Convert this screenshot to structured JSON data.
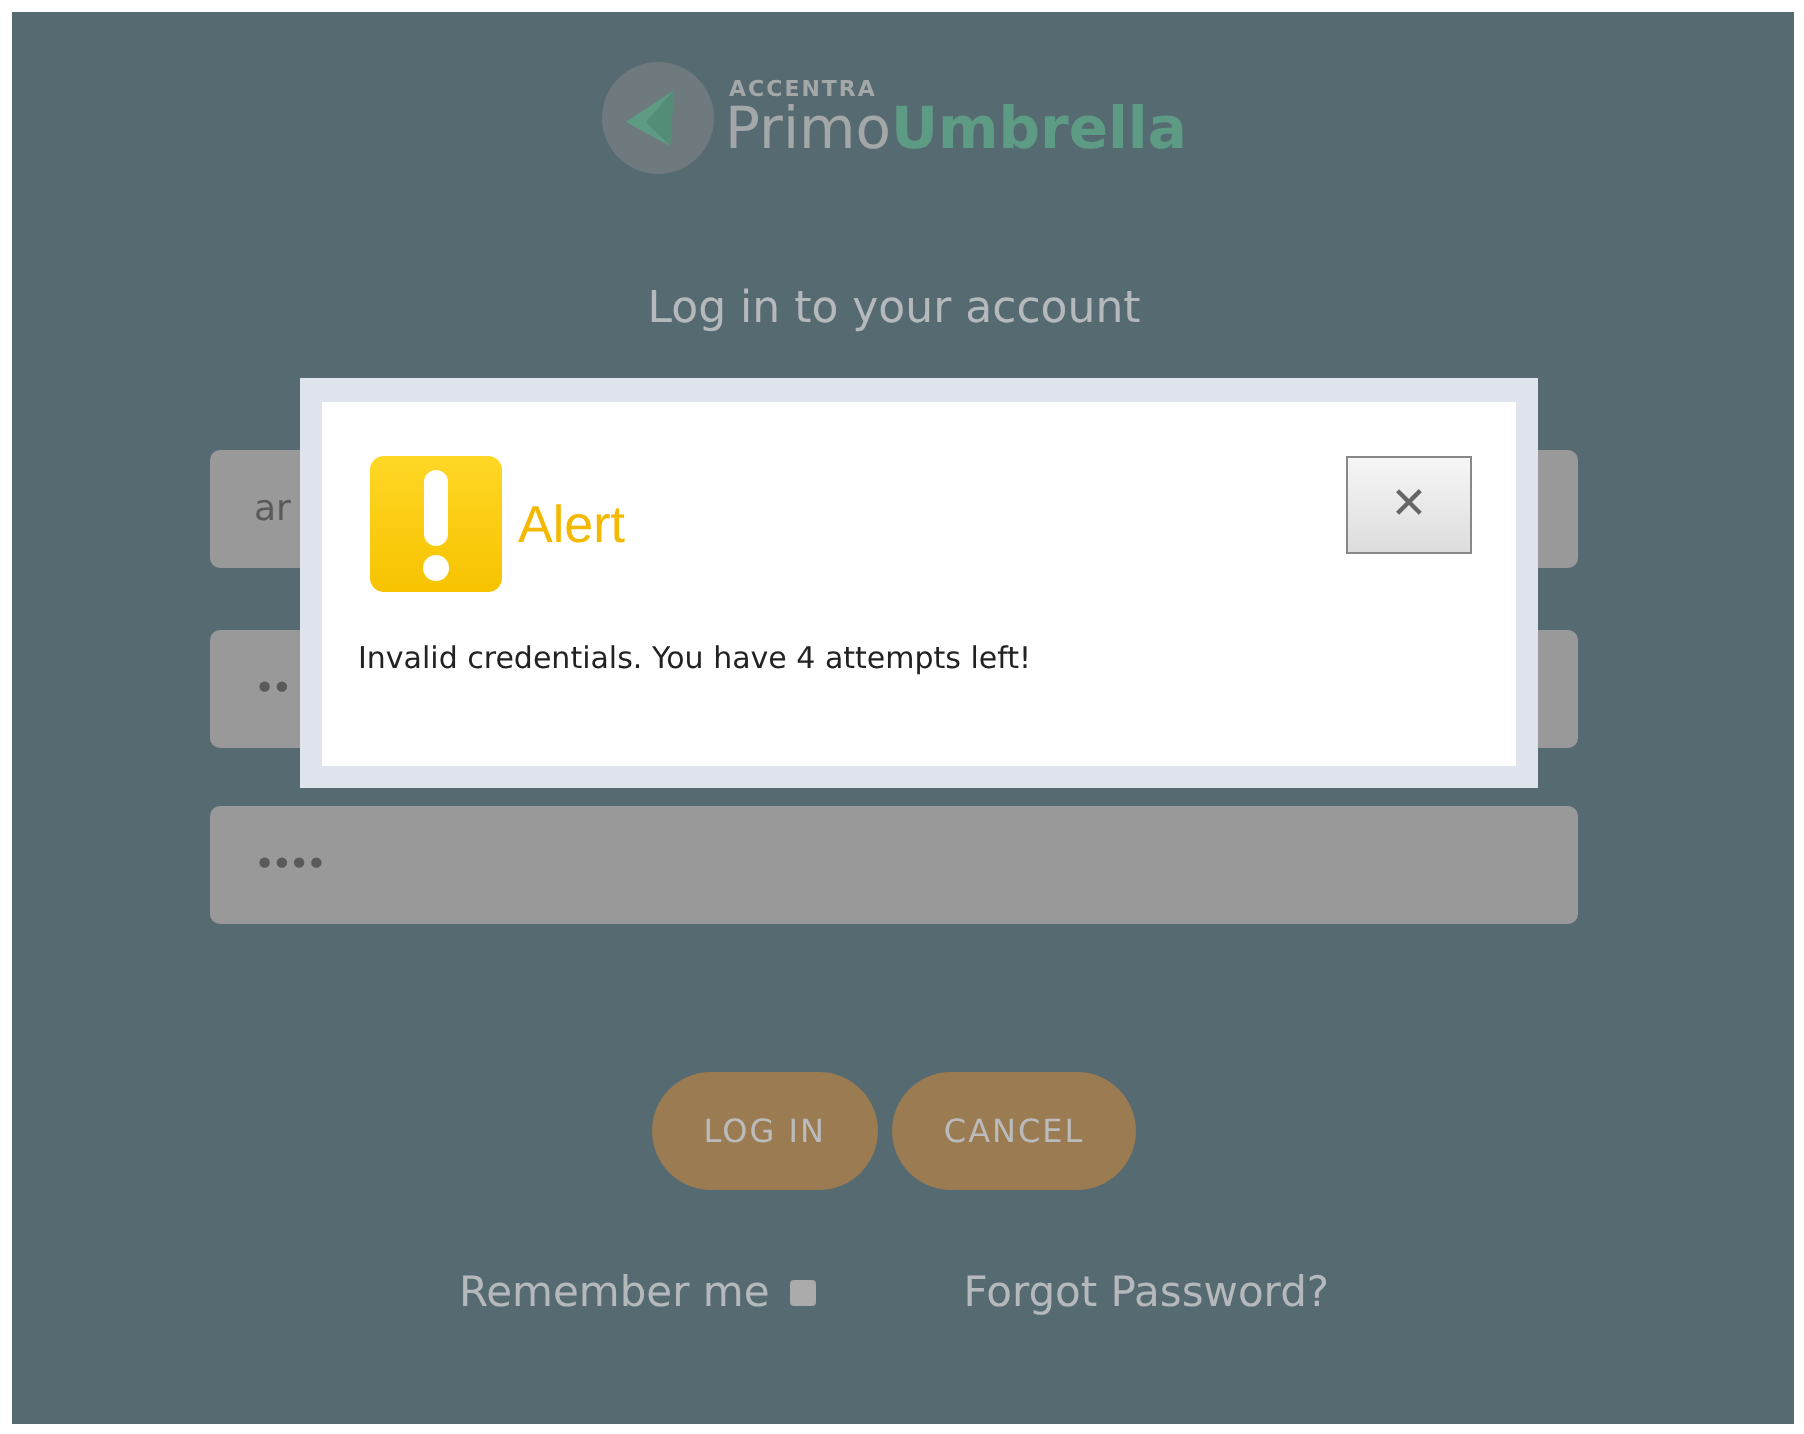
{
  "logo": {
    "brand": "ACCENTRA",
    "name_light": "Primo",
    "name_bold": "Umbrella"
  },
  "heading": "Log in to your account",
  "fields": [
    {
      "kind": "text",
      "value": "ar"
    },
    {
      "kind": "password",
      "value": "••"
    },
    {
      "kind": "password",
      "value": "••••"
    }
  ],
  "buttons": [
    "LOG IN",
    "CANCEL"
  ],
  "remember_me": {
    "label": "Remember me",
    "checked": false
  },
  "forgot_link": "Forgot Password?",
  "dialog": {
    "title": "Alert",
    "message": "Invalid credentials. You have 4 attempts left!",
    "close": "✕"
  }
}
